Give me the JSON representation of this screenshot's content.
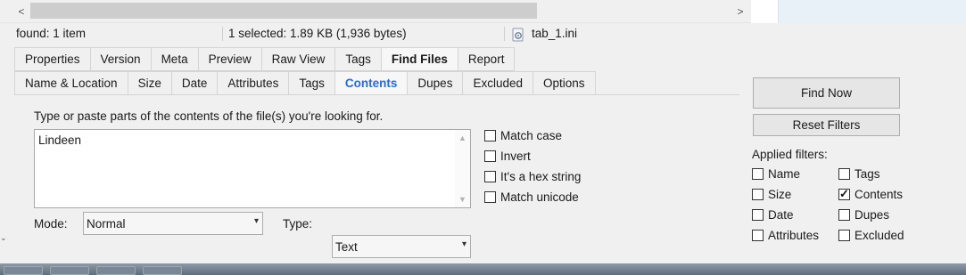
{
  "scrollbar": {
    "left_arrow": "<",
    "right_arrow": ">"
  },
  "status": {
    "found": "found: 1 item",
    "selected": "1 selected: 1.89 KB (1,936 bytes)",
    "file_name": "tab_1.ini"
  },
  "tabs_row1": [
    {
      "label": "Properties"
    },
    {
      "label": "Version"
    },
    {
      "label": "Meta"
    },
    {
      "label": "Preview"
    },
    {
      "label": "Raw View"
    },
    {
      "label": "Tags"
    },
    {
      "label": "Find Files"
    },
    {
      "label": "Report"
    }
  ],
  "tabs_row2": [
    {
      "label": "Name & Location"
    },
    {
      "label": "Size"
    },
    {
      "label": "Date"
    },
    {
      "label": "Attributes"
    },
    {
      "label": "Tags"
    },
    {
      "label": "Contents"
    },
    {
      "label": "Dupes"
    },
    {
      "label": "Excluded"
    },
    {
      "label": "Options"
    }
  ],
  "contents": {
    "instruction": "Type or paste parts of the contents of the file(s) you're looking for.",
    "search_text": "Lindeen",
    "options": [
      {
        "label": "Match case",
        "checked": false
      },
      {
        "label": "Invert",
        "checked": false
      },
      {
        "label": "It's a hex string",
        "checked": false
      },
      {
        "label": "Match unicode",
        "checked": false
      }
    ],
    "mode_label": "Mode:",
    "mode_value": "Normal",
    "type_label": "Type:",
    "type_value": "Text"
  },
  "buttons": {
    "find_now": "Find Now",
    "reset_filters": "Reset Filters"
  },
  "applied_filters": {
    "title": "Applied filters:",
    "items": [
      {
        "label": "Name",
        "checked": false
      },
      {
        "label": "Tags",
        "checked": false
      },
      {
        "label": "Size",
        "checked": false
      },
      {
        "label": "Contents",
        "checked": true
      },
      {
        "label": "Date",
        "checked": false
      },
      {
        "label": "Dupes",
        "checked": false
      },
      {
        "label": "Attributes",
        "checked": false
      },
      {
        "label": "Excluded",
        "checked": false
      }
    ]
  }
}
